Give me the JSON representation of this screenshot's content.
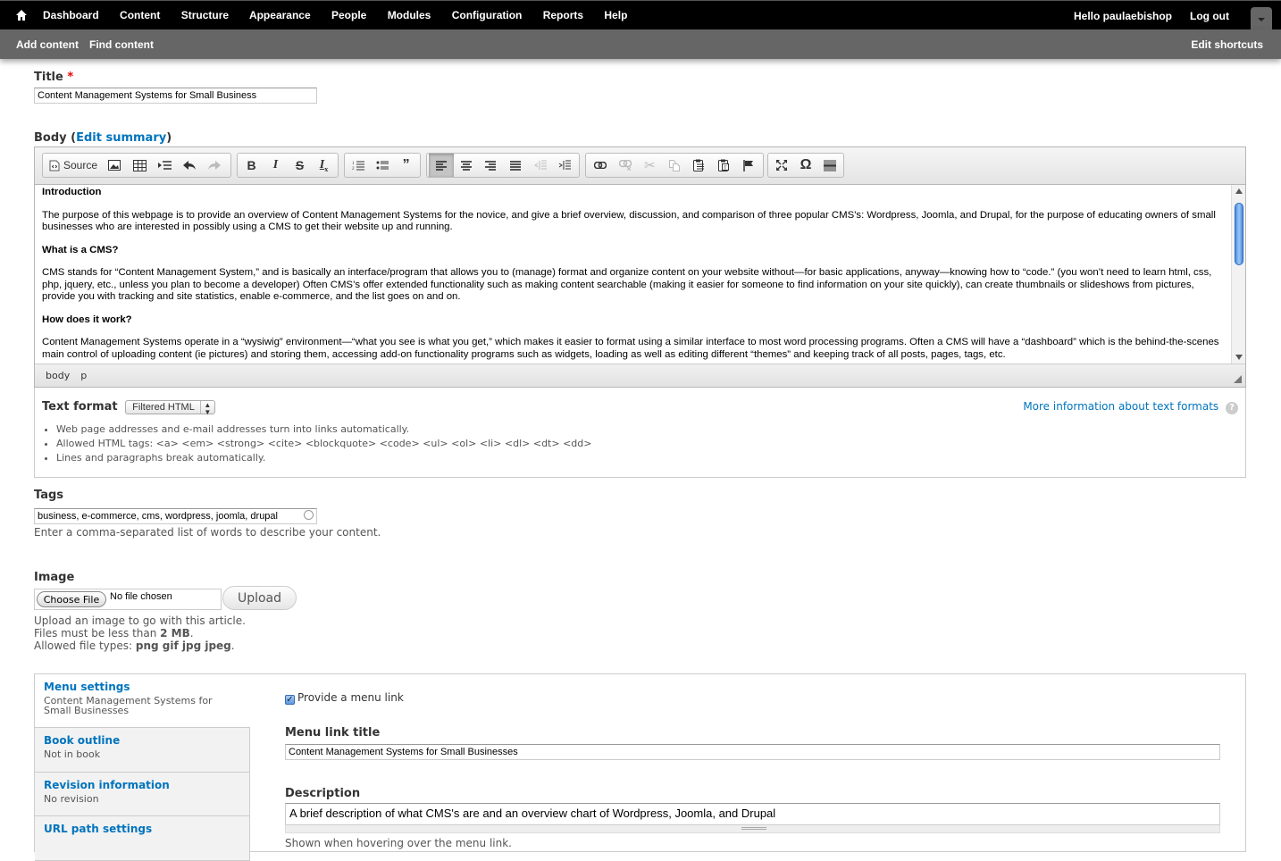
{
  "toolbar": {
    "menu": [
      "Dashboard",
      "Content",
      "Structure",
      "Appearance",
      "People",
      "Modules",
      "Configuration",
      "Reports",
      "Help"
    ],
    "hello_prefix": "Hello ",
    "username": "paulaebishop",
    "logout": "Log out",
    "shortcuts": [
      "Add content",
      "Find content"
    ],
    "edit_shortcuts": "Edit shortcuts"
  },
  "title_field": {
    "label": "Title",
    "required_mark": "*",
    "value": "Content Management Systems for Small Business"
  },
  "body_field": {
    "label": "Body",
    "edit_summary": "Edit summary",
    "toolbar": {
      "source_label": "Source",
      "buttons": [
        "image",
        "table",
        "horizontal-rule",
        "undo",
        "redo",
        "bold",
        "italic",
        "strikethrough",
        "remove-format",
        "numbered-list",
        "bulleted-list",
        "blockquote",
        "align-left",
        "align-center",
        "align-right",
        "justify",
        "outdent",
        "indent",
        "link",
        "unlink",
        "cut",
        "copy",
        "paste",
        "paste-text",
        "anchor",
        "maximize",
        "special-char",
        "page-break"
      ]
    },
    "content": [
      {
        "type": "heading",
        "text": "Introduction"
      },
      {
        "type": "para",
        "text": "The purpose of this webpage is to provide an overview of Content Management Systems for the novice, and give a brief overview, discussion, and comparison of three popular CMS's: Wordpress, Joomla, and Drupal, for the purpose of educating owners of small businesses who are interested in possibly using a CMS to get their website up and running."
      },
      {
        "type": "heading",
        "text": "What is a CMS?"
      },
      {
        "type": "para",
        "text": "CMS stands for “Content Management System,” and is basically an interface/program that allows you to (manage) format and organize content on your website without—for basic applications, anyway—knowing how to “code.” (you won’t need to learn html, css, php, jquery, etc., unless you plan to become a developer) Often CMS’s offer extended functionality such as making content searchable (making it easier for someone to find information on your site quickly), can create thumbnails or slideshows from pictures, provide you with tracking and site statistics, enable e-commerce, and the list goes on and on."
      },
      {
        "type": "heading",
        "text": "How does it work?"
      },
      {
        "type": "para",
        "text": "Content Management Systems operate in a “wysiwig” environment—“what you see is what you get,” which makes it easier to format using a similar interface to most word processing programs. Often a CMS will have a “dashboard” which is the behind-the-scenes main control of uploading content (ie pictures) and storing them, accessing add-on functionality programs such as widgets, loading as well as editing different “themes” and keeping track of all posts, pages, tags, etc."
      }
    ],
    "path": [
      "body",
      "p"
    ]
  },
  "text_format": {
    "label": "Text format",
    "selected": "Filtered HTML",
    "more_info": "More information about text formats",
    "tips": [
      "Web page addresses and e-mail addresses turn into links automatically.",
      "Allowed HTML tags: <a> <em> <strong> <cite> <blockquote> <code> <ul> <ol> <li> <dl> <dt> <dd>",
      "Lines and paragraphs break automatically."
    ]
  },
  "tags_field": {
    "label": "Tags",
    "value": "business, e-commerce, cms, wordpress, joomla, drupal",
    "description": "Enter a comma-separated list of words to describe your content."
  },
  "image_field": {
    "label": "Image",
    "choose_file": "Choose File",
    "no_file": "No file chosen",
    "upload": "Upload",
    "desc_line1": "Upload an image to go with this article.",
    "desc_line2_prefix": "Files must be less than ",
    "max_size": "2 MB",
    "desc_line3_prefix": "Allowed file types: ",
    "file_types": "png gif jpg jpeg"
  },
  "vertical_tabs": [
    {
      "title": "Menu settings",
      "summary": "Content Management Systems for Small Businesses"
    },
    {
      "title": "Book outline",
      "summary": "Not in book"
    },
    {
      "title": "Revision information",
      "summary": "No revision"
    },
    {
      "title": "URL path settings",
      "summary": ""
    }
  ],
  "menu_settings": {
    "provide_link_label": "Provide a menu link",
    "provide_link_checked": true,
    "link_title_label": "Menu link title",
    "link_title_value": "Content Management Systems for Small Businesses",
    "description_label": "Description",
    "description_value": "A brief description of what CMS's are and an overview chart of Wordpress, Joomla, and Drupal",
    "description_help": "Shown when hovering over the menu link."
  }
}
